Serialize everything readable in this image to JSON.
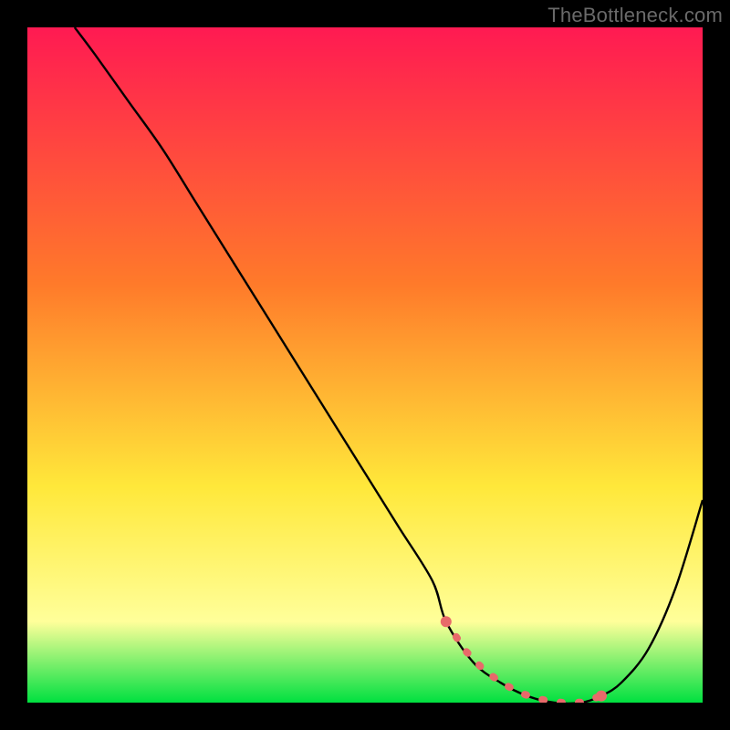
{
  "attribution": "TheBottleneck.com",
  "colors": {
    "bg": "#000000",
    "grad_top": "#ff1a52",
    "grad_mid1": "#ff7a2a",
    "grad_mid2": "#ffe83a",
    "grad_low": "#ffff9a",
    "grad_bottom": "#00e040",
    "curve": "#000000",
    "highlight": "#e86a6a",
    "attribution_text": "#6a6a6a"
  },
  "chart_data": {
    "type": "line",
    "title": "",
    "xlabel": "",
    "ylabel": "",
    "xlim": [
      0,
      100
    ],
    "ylim": [
      0,
      100
    ],
    "series": [
      {
        "name": "bottleneck-curve",
        "x": [
          7,
          10,
          15,
          20,
          25,
          30,
          35,
          40,
          45,
          50,
          55,
          60,
          62,
          66,
          70,
          74,
          78,
          82,
          85,
          88,
          92,
          96,
          100
        ],
        "y": [
          100,
          96,
          89,
          82,
          74,
          66,
          58,
          50,
          42,
          34,
          26,
          18,
          12,
          6,
          3,
          1,
          0,
          0,
          1,
          3,
          8,
          17,
          30
        ]
      }
    ],
    "highlight_segment": {
      "x_start": 62,
      "x_end": 85,
      "note": "pink dotted low-bottleneck zone"
    }
  }
}
